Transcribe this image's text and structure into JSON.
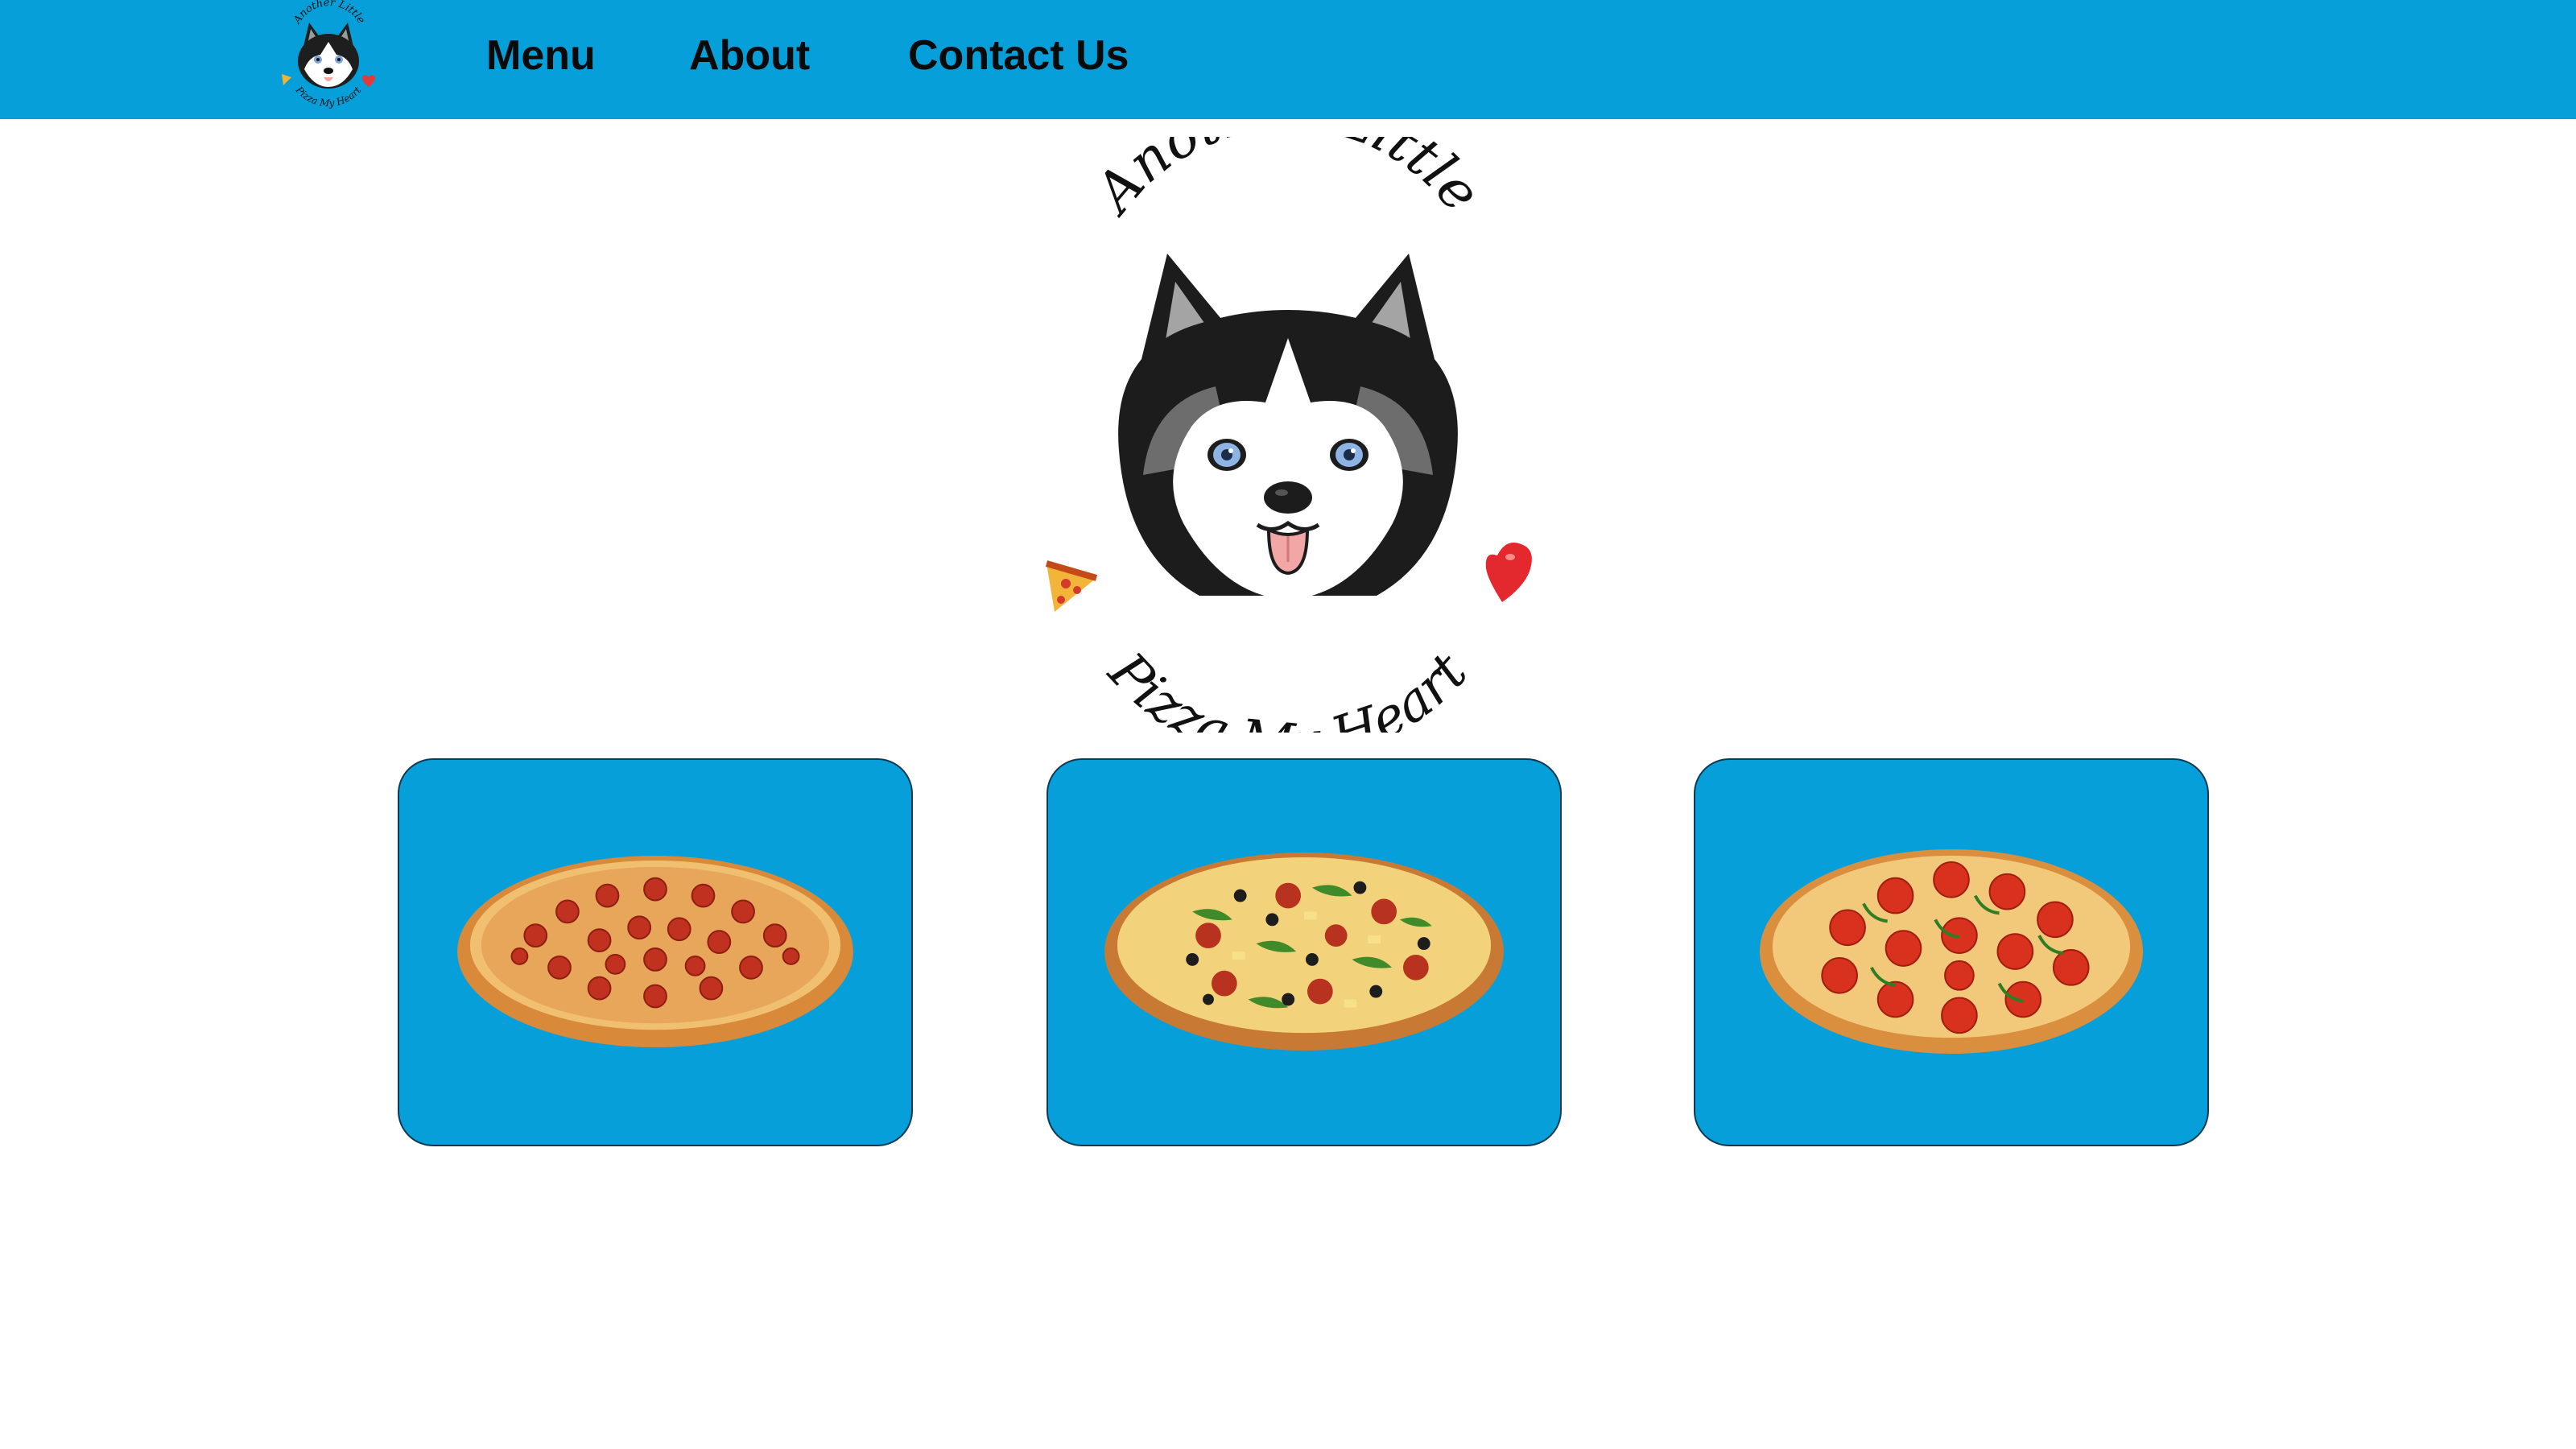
{
  "nav": {
    "logo_icon": "husky-logo-icon",
    "items": [
      {
        "label": "Menu"
      },
      {
        "label": "About"
      },
      {
        "label": "Contact Us"
      }
    ]
  },
  "hero": {
    "logo_icon": "husky-logo-icon",
    "text_top": "Another Little",
    "text_bottom": "Pizza My Heart"
  },
  "cards": [
    {
      "icon": "pepperoni-pizza-icon"
    },
    {
      "icon": "supreme-pizza-icon"
    },
    {
      "icon": "tomato-pizza-icon"
    }
  ],
  "colors": {
    "brand_blue": "#069fd9",
    "text": "#0a0a0a"
  }
}
